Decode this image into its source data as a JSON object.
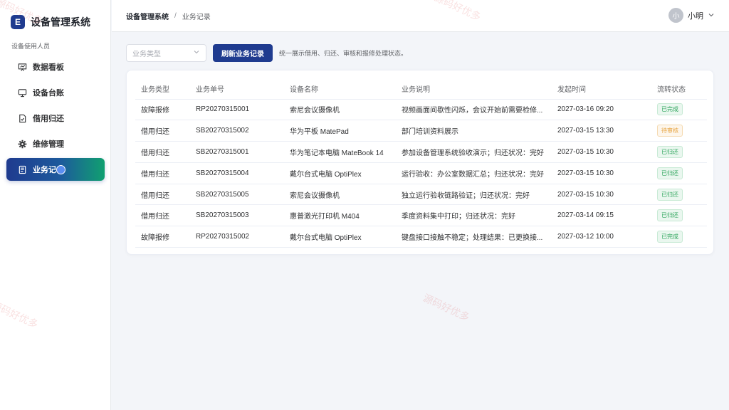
{
  "brand": {
    "logo_letter": "E",
    "title": "设备管理系统"
  },
  "sidebar": {
    "section_label": "设备使用人员",
    "items": [
      {
        "label": "数据看板",
        "icon": "dashboard-icon"
      },
      {
        "label": "设备台账",
        "icon": "monitor-icon"
      },
      {
        "label": "借用归还",
        "icon": "document-check-icon"
      },
      {
        "label": "维修管理",
        "icon": "gear-icon"
      },
      {
        "label": "业务记",
        "icon": "document-list-icon",
        "active": true
      }
    ]
  },
  "header": {
    "breadcrumb_root": "设备管理系统",
    "breadcrumb_sep": "/",
    "breadcrumb_current": "业务记录",
    "user_avatar": "小",
    "user_name": "小明"
  },
  "toolbar": {
    "select_placeholder": "业务类型",
    "refresh_label": "刷新业务记录",
    "hint": "统一展示借用、归还、审核和报修处理状态。"
  },
  "table": {
    "columns": [
      "业务类型",
      "业务单号",
      "设备名称",
      "业务说明",
      "发起时间",
      "流转状态"
    ],
    "rows": [
      {
        "type": "故障报修",
        "id": "RP20270315001",
        "device": "索尼会议摄像机",
        "desc": "视频画面间歇性闪烁，会议开始前需要检修...",
        "time": "2027-03-16 09:20",
        "status": "已完成",
        "status_color": "green"
      },
      {
        "type": "借用归还",
        "id": "SB20270315002",
        "device": "华为平板 MatePad",
        "desc": "部门培训资料展示",
        "time": "2027-03-15 13:30",
        "status": "待审核",
        "status_color": "orange"
      },
      {
        "type": "借用归还",
        "id": "SB20270315001",
        "device": "华为笔记本电脑 MateBook 14",
        "desc": "参加设备管理系统验收演示；归还状况：完好",
        "time": "2027-03-15 10:30",
        "status": "已归还",
        "status_color": "green"
      },
      {
        "type": "借用归还",
        "id": "SB20270315004",
        "device": "戴尔台式电脑 OptiPlex",
        "desc": "运行验收：办公室数据汇总；归还状况：完好",
        "time": "2027-03-15 10:30",
        "status": "已归还",
        "status_color": "green"
      },
      {
        "type": "借用归还",
        "id": "SB20270315005",
        "device": "索尼会议摄像机",
        "desc": "独立运行验收链路验证；归还状况：完好",
        "time": "2027-03-15 10:30",
        "status": "已归还",
        "status_color": "green"
      },
      {
        "type": "借用归还",
        "id": "SB20270315003",
        "device": "惠普激光打印机 M404",
        "desc": "季度资料集中打印；归还状况：完好",
        "time": "2027-03-14 09:15",
        "status": "已归还",
        "status_color": "green"
      },
      {
        "type": "故障报修",
        "id": "RP20270315002",
        "device": "戴尔台式电脑 OptiPlex",
        "desc": "键盘接口接触不稳定；处理结果：已更换接...",
        "time": "2027-03-12 10:00",
        "status": "已完成",
        "status_color": "green"
      }
    ]
  },
  "watermarks": [
    "源码好优多",
    "源码好优多",
    "源码好优多",
    "源码好优多"
  ]
}
